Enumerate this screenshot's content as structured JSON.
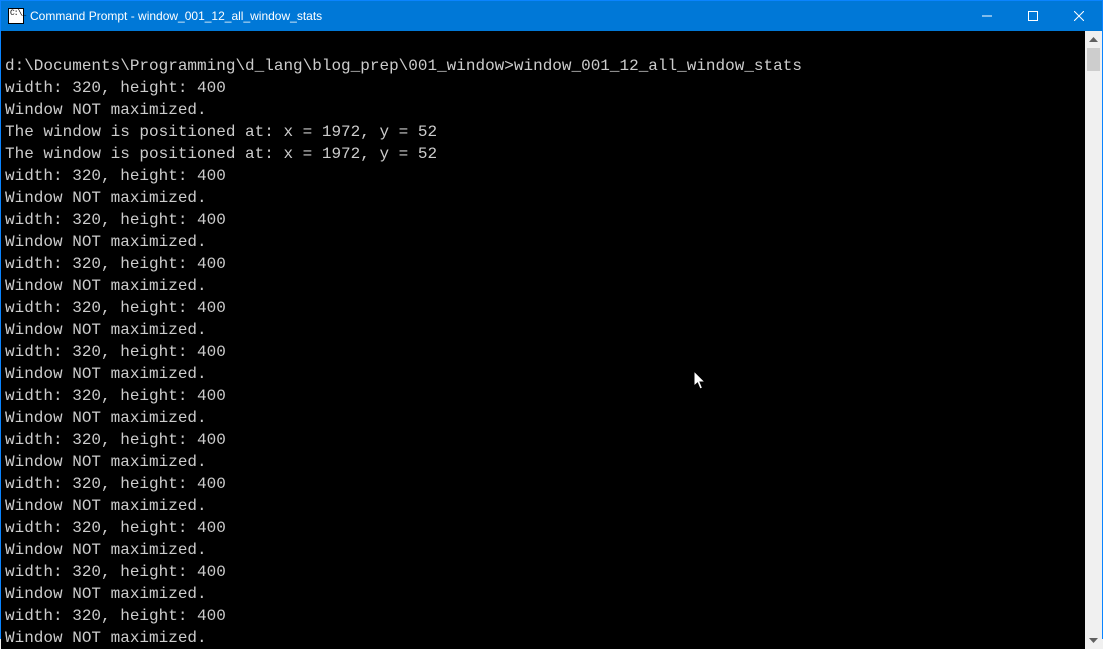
{
  "titlebar": {
    "title": "Command Prompt - window_001_12_all_window_stats"
  },
  "prompt": {
    "path": "d:\\Documents\\Programming\\d_lang\\blog_prep\\001_window>",
    "command": "window_001_12_all_window_stats"
  },
  "output_lines": [
    "width: 320, height: 400",
    "Window NOT maximized.",
    "The window is positioned at: x = 1972, y = 52",
    "The window is positioned at: x = 1972, y = 52",
    "width: 320, height: 400",
    "Window NOT maximized.",
    "width: 320, height: 400",
    "Window NOT maximized.",
    "width: 320, height: 400",
    "Window NOT maximized.",
    "width: 320, height: 400",
    "Window NOT maximized.",
    "width: 320, height: 400",
    "Window NOT maximized.",
    "width: 320, height: 400",
    "Window NOT maximized.",
    "width: 320, height: 400",
    "Window NOT maximized.",
    "width: 320, height: 400",
    "Window NOT maximized.",
    "width: 320, height: 400",
    "Window NOT maximized.",
    "width: 320, height: 400",
    "Window NOT maximized.",
    "width: 320, height: 400",
    "Window NOT maximized."
  ],
  "scrollbar": {
    "min": 0,
    "max": 1000,
    "viewport": 40,
    "position": 0
  }
}
